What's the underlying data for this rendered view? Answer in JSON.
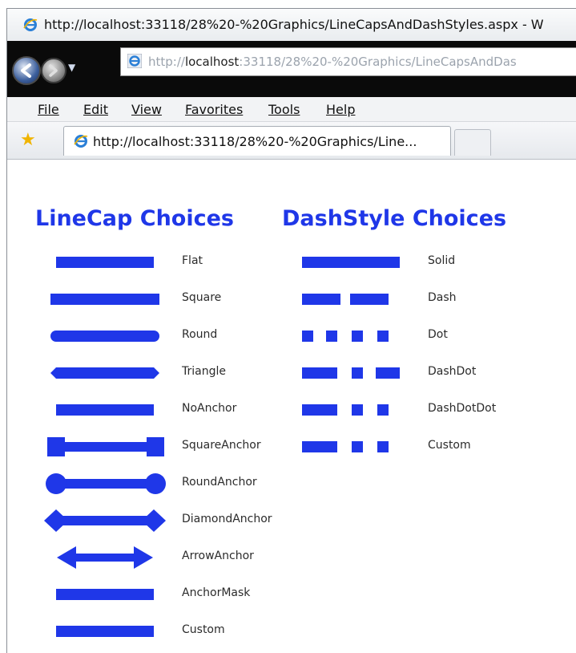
{
  "window": {
    "title": "http://localhost:33118/28%20-%20Graphics/LineCapsAndDashStyles.aspx - W"
  },
  "address_bar": {
    "url_prefix": "http://",
    "url_host": "localhost",
    "url_rest": ":33118/28%20-%20Graphics/LineCapsAndDas"
  },
  "menu": {
    "items": [
      "File",
      "Edit",
      "View",
      "Favorites",
      "Tools",
      "Help"
    ]
  },
  "tab": {
    "title": "http://localhost:33118/28%20-%20Graphics/Line..."
  },
  "page": {
    "linecap_heading": "LineCap Choices",
    "dashstyle_heading": "DashStyle Choices",
    "linecaps": [
      "Flat",
      "Square",
      "Round",
      "Triangle",
      "NoAnchor",
      "SquareAnchor",
      "RoundAnchor",
      "DiamondAnchor",
      "ArrowAnchor",
      "AnchorMask",
      "Custom"
    ],
    "dashstyles": [
      "Solid",
      "Dash",
      "Dot",
      "DashDot",
      "DashDotDot",
      "Custom"
    ]
  },
  "colors": {
    "line": "#1f37e8",
    "heading": "#1f37e8",
    "star": "#f0b400"
  },
  "icons": {
    "ie": "ie-logo-icon",
    "back": "back-arrow-icon",
    "forward": "forward-arrow-icon",
    "favorites": "favorites-star-icon"
  }
}
